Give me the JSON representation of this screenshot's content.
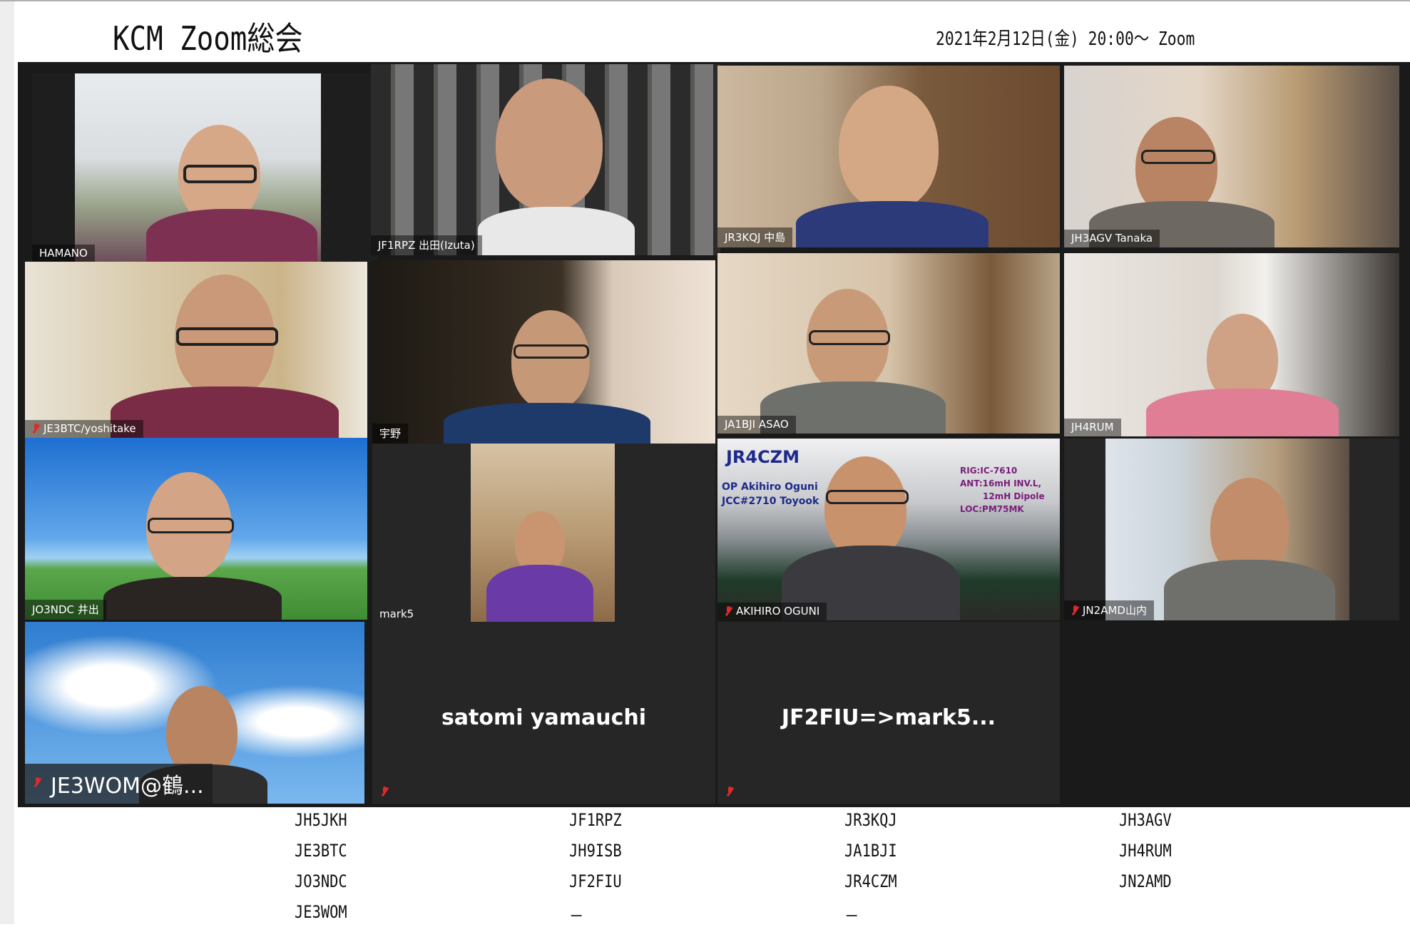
{
  "header": {
    "title": "KCM Zoom総会",
    "date_line": "2021年2月12日(金) 20:00～ Zoom"
  },
  "participants": [
    {
      "label": "HAMANO"
    },
    {
      "label": "JF1RPZ 出田(Izuta)"
    },
    {
      "label": "JR3KQJ 中島"
    },
    {
      "label": "JH3AGV Tanaka"
    },
    {
      "label": "JE3BTC/yoshitake"
    },
    {
      "label": "宇野"
    },
    {
      "label": "JA1BJI ASAO"
    },
    {
      "label": "JH4RUM"
    },
    {
      "label": "JO3NDC 井出"
    },
    {
      "label": "mark5"
    },
    {
      "label": "AKIHIRO OGUNI"
    },
    {
      "label": "JN2AMD山内"
    },
    {
      "label": "JE3WOM@鶴..."
    },
    {
      "label": "satomi yamauchi"
    },
    {
      "label": "JF2FIU=>mark5..."
    }
  ],
  "oguni_background": {
    "callsign": "JR4CZM",
    "op_line": "OP Akihiro Oguni",
    "jcc_line": "JCC#2710 Toyook",
    "rig": "RIG:IC-7610",
    "ant1": "ANT:16mH INV.L,",
    "ant2": "12mH Dipole",
    "loc": "LOC:PM75MK"
  },
  "callsign_table": {
    "col1": [
      "JH5JKH",
      "JE3BTC",
      "JO3NDC",
      "JE3WOM"
    ],
    "col2": [
      "JF1RPZ",
      "JH9ISB",
      "JF2FIU",
      "－"
    ],
    "col3": [
      "JR3KQJ",
      "JA1BJI",
      "JR4CZM",
      "－"
    ],
    "col4": [
      "JH3AGV",
      "JH4RUM",
      "JN2AMD"
    ]
  }
}
